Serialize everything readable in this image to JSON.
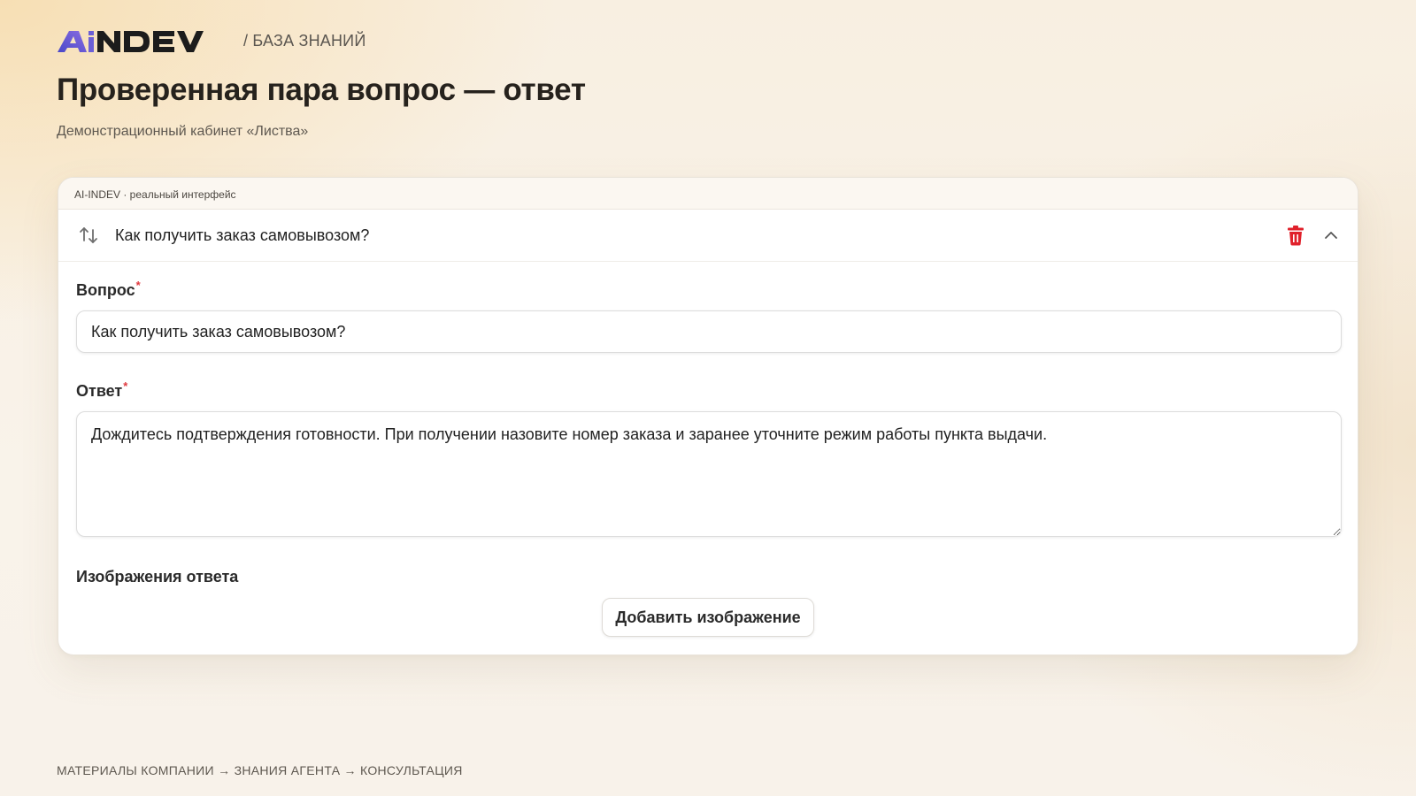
{
  "header": {
    "logo_text": "AiNDEV",
    "breadcrumb": "/ БАЗА ЗНАНИЙ",
    "title": "Проверенная пара вопрос — ответ",
    "subtitle": "Демонстрационный кабинет «Листва»"
  },
  "card": {
    "caption": "AI-INDEV · реальный интерфейс",
    "item_title": "Как получить заказ самовывозом?",
    "icons": {
      "reorder": "sort-arrows-icon",
      "delete": "trash-icon",
      "collapse": "chevron-up-icon"
    },
    "colors": {
      "delete_icon": "#e0212b",
      "required_mark": "#e0393e",
      "logo_accent": "#6b5fd6"
    },
    "form": {
      "question_label": "Вопрос",
      "question_value": "Как получить заказ самовывозом?",
      "answer_label": "Ответ",
      "answer_value": "Дождитесь подтверждения готовности. При получении назовите номер заказа и заранее уточните режим работы пункта выдачи.",
      "required_mark": "*",
      "images_label": "Изображения ответа",
      "add_image_button": "Добавить изображение"
    }
  },
  "footer": {
    "flow": "МАТЕРИАЛЫ КОМПАНИИ → ЗНАНИЯ АГЕНТА → КОНСУЛЬТАЦИЯ"
  }
}
